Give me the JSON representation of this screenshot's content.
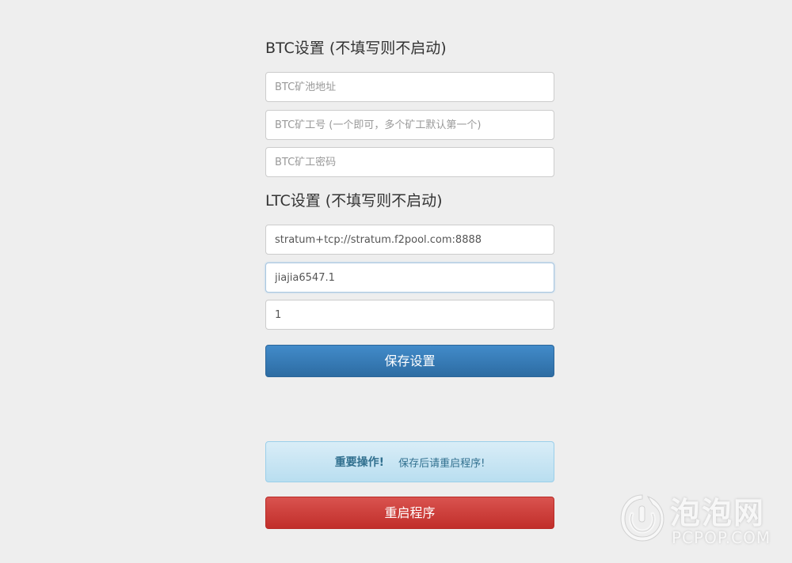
{
  "btc_section": {
    "title": "BTC设置 (不填写则不启动)",
    "pool_placeholder": "BTC矿池地址",
    "worker_placeholder": "BTC矿工号 (一个即可，多个矿工默认第一个)",
    "password_placeholder": "BTC矿工密码"
  },
  "ltc_section": {
    "title": "LTC设置 (不填写则不启动)",
    "pool_value": "stratum+tcp://stratum.f2pool.com:8888",
    "worker_value": "jiajia6547.1",
    "password_value": "1"
  },
  "save_button_label": "保存设置",
  "alert": {
    "strong": "重要操作!",
    "message": "保存后请重启程序!"
  },
  "restart_button_label": "重启程序",
  "watermark": {
    "brand": "泡泡网",
    "domain": "PCPOP.COM"
  },
  "colors": {
    "background": "#eeeeee",
    "primary": "#337ab7",
    "danger": "#d9534f",
    "alert_info": "#d9edf7"
  }
}
